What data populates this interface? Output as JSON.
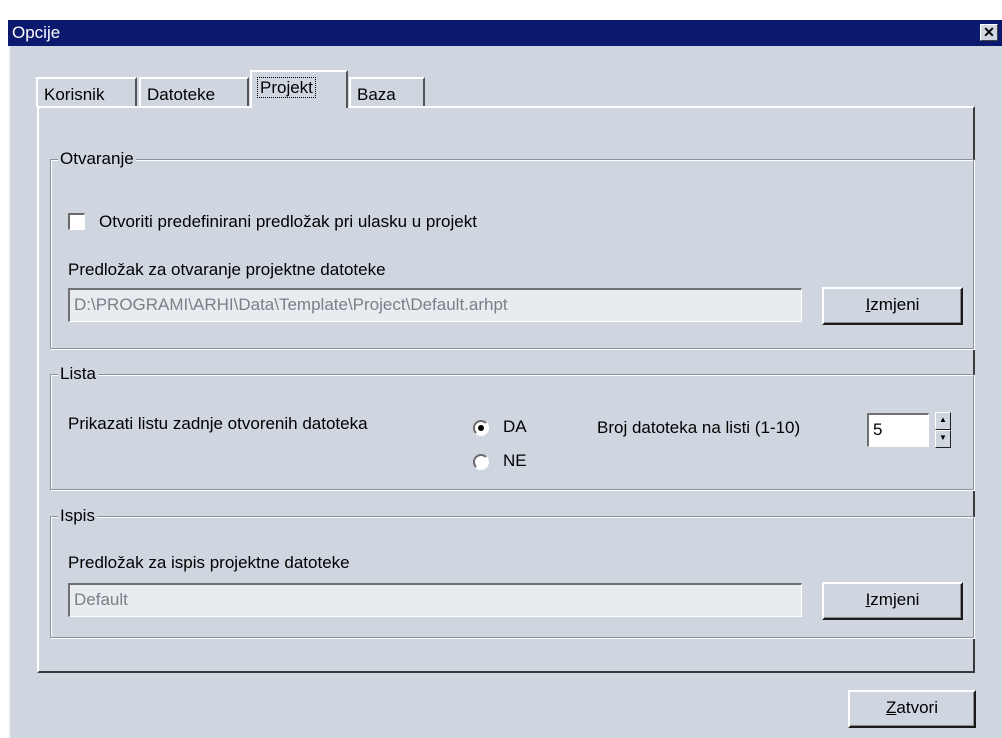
{
  "window": {
    "title": "Opcije",
    "close_glyph": "✕"
  },
  "tabs": [
    {
      "label": "Korisnik"
    },
    {
      "label": "Datoteke"
    },
    {
      "label": "Projekt",
      "active": true
    },
    {
      "label": "Baza"
    }
  ],
  "otvaranje": {
    "title": "Otvaranje",
    "checkbox_label": "Otvoriti predefinirani predložak pri ulasku u projekt",
    "checked": false,
    "template_label": "Predložak za otvaranje projektne datoteke",
    "template_path": "D:\\PROGRAMI\\ARHI\\Data\\Template\\Project\\Default.arhpt",
    "change_button_prefix": "",
    "change_button_mnemonic": "I",
    "change_button_rest": "zmjeni"
  },
  "lista": {
    "title": "Lista",
    "show_label": "Prikazati listu zadnje otvorenih datoteka",
    "option_yes": "DA",
    "option_no": "NE",
    "selected": "DA",
    "count_label": "Broj datoteka na listi (1-10)",
    "count_value": "5",
    "up_glyph": "▲",
    "down_glyph": "▼"
  },
  "ispis": {
    "title": "Ispis",
    "template_label": "Predložak za ispis projektne datoteke",
    "template_path": "Default",
    "change_button_mnemonic": "I",
    "change_button_rest": "zmjeni"
  },
  "footer": {
    "close_button_mnemonic": "Z",
    "close_button_rest": "atvori"
  },
  "colors": {
    "titlebar": "#0b1a6e",
    "dialog_bg": "#cfd6e0",
    "disabled_field_bg": "#e8ebf0",
    "disabled_text": "#7b7f86"
  }
}
